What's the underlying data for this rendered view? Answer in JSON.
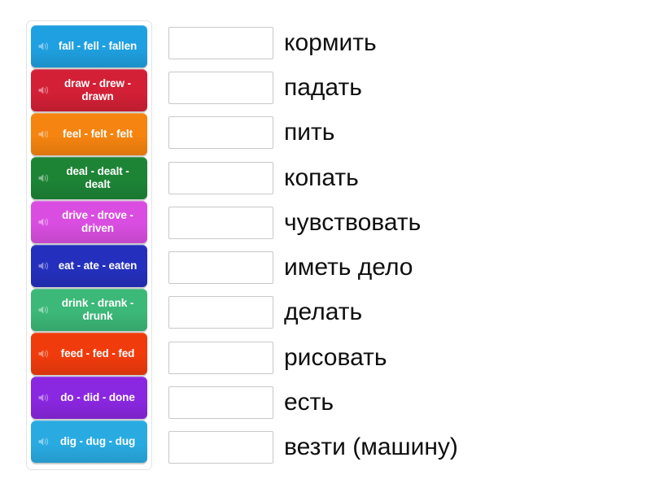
{
  "activity": {
    "type": "match-up-drag-and-drop",
    "tile_icon": "speaker-icon"
  },
  "tiles": [
    {
      "label": "fall - fell - fallen",
      "color": "#1fa0e0"
    },
    {
      "label": "draw - drew - drawn",
      "color": "#d32036"
    },
    {
      "label": "feel - felt - felt",
      "color": "#f58410"
    },
    {
      "label": "deal - dealt - dealt",
      "color": "#1d8436"
    },
    {
      "label": "drive - drove - driven",
      "color": "#d94ee0"
    },
    {
      "label": "eat - ate - eaten",
      "color": "#2430bd"
    },
    {
      "label": "drink - drank - drunk",
      "color": "#3cb878"
    },
    {
      "label": "feed - fed - fed",
      "color": "#f03b0c"
    },
    {
      "label": "do - did - done",
      "color": "#8a27e0"
    },
    {
      "label": "dig - dug - dug",
      "color": "#29abe2"
    }
  ],
  "rows": [
    {
      "answer": "",
      "prompt": "кормить"
    },
    {
      "answer": "",
      "prompt": "падать"
    },
    {
      "answer": "",
      "prompt": "пить"
    },
    {
      "answer": "",
      "prompt": "копать"
    },
    {
      "answer": "",
      "prompt": "чувствовать"
    },
    {
      "answer": "",
      "prompt": "иметь дело"
    },
    {
      "answer": "",
      "prompt": "делать"
    },
    {
      "answer": "",
      "prompt": "рисовать"
    },
    {
      "answer": "",
      "prompt": "есть"
    },
    {
      "answer": "",
      "prompt": "везти (машину)"
    }
  ],
  "colors": {
    "page_background": "#ffffff",
    "panel_border": "#e3e3e3",
    "dropbox_border": "#c8c8c8",
    "prompt_text": "#0f0f0f",
    "tile_text": "#ffffff"
  }
}
